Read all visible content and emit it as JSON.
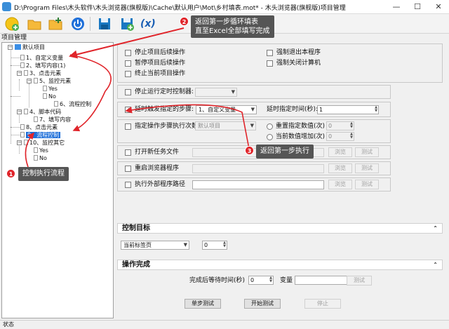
{
  "window": {
    "title": "D:\\Program Files\\木头软件\\木头浏览器(旗舰版)\\Cache\\默认用户\\Mot\\乡村填表.mot* - 木头浏览器(旗舰版)项目管理",
    "minimize": "—",
    "maximize": "☐",
    "close": "✕"
  },
  "toolbar": {
    "icons": [
      "new-project-icon",
      "open-folder-icon",
      "add-folder-icon",
      "power-icon",
      "save-icon",
      "save-as-icon",
      "variable-icon"
    ],
    "variable_label": "(x)"
  },
  "tree": {
    "header": "项目管理",
    "nodes": [
      {
        "label": "默认项目"
      },
      {
        "label": "1、自定义变量"
      },
      {
        "label": "2、填写内容(1)"
      },
      {
        "label": "3、点击元素"
      },
      {
        "label": "5、监控元素"
      },
      {
        "label": "Yes"
      },
      {
        "label": "No"
      },
      {
        "label": "6、流程控制"
      },
      {
        "label": "4、脚本代码"
      },
      {
        "label": "7、填写内容"
      },
      {
        "label": "8、点击元素"
      },
      {
        "label": "9、流程控制"
      },
      {
        "label": "10、监控其它"
      },
      {
        "label": "Yes"
      },
      {
        "label": "No"
      }
    ],
    "tree_signs": {
      "minus": "−"
    }
  },
  "options": {
    "stop_after": "停止项目后续操作",
    "pause_after": "暂停项目后续操作",
    "terminate": "终止当前项目操作",
    "force_exit": "强制退出本程序",
    "force_shutdown": "强制关闭计算机",
    "stop_timer": "停止运行定时控制器:",
    "delay_trigger": "延时触发指定的步骤:",
    "delay_step_value": "1、自定义变量",
    "delay_time_label": "延时指定时间(秒):",
    "delay_time_value": "1",
    "exec_count_label": "指定操作步骤执行次数:",
    "exec_count_value": "默认项目",
    "reset_value_label": "重置指定数值(次)",
    "increase_value_label": "当前数值增加(次)",
    "reset_value": "0",
    "increase_value": "0",
    "open_task": "打开新任务文件",
    "restart_browser": "重启浏览器程序",
    "run_external": "执行外部程序路径",
    "browse": "浏览",
    "test": "测试",
    "check_mark": "✓"
  },
  "control_target": {
    "title": "控制目标",
    "tab_value": "当前标签页",
    "index_value": "0",
    "chevron": "⌃"
  },
  "complete": {
    "title": "操作完成",
    "wait_label": "完成后等待时间(秒)",
    "wait_value": "0",
    "var_label": "变量",
    "test_btn": "测试",
    "chevron": "⌃"
  },
  "actions": {
    "single_test": "单步测试",
    "start_test": "开始测试",
    "stop": "停止"
  },
  "status": {
    "text": "状态"
  },
  "annotations": {
    "c1": "控制执行流程",
    "c2_line1": "返回第一步循环填表",
    "c2_line2": "直至Excel全部填写完成",
    "c3": "返回第一步执行",
    "b1": "1",
    "b2": "2",
    "b3": "3",
    "accent": "#e0242a"
  }
}
